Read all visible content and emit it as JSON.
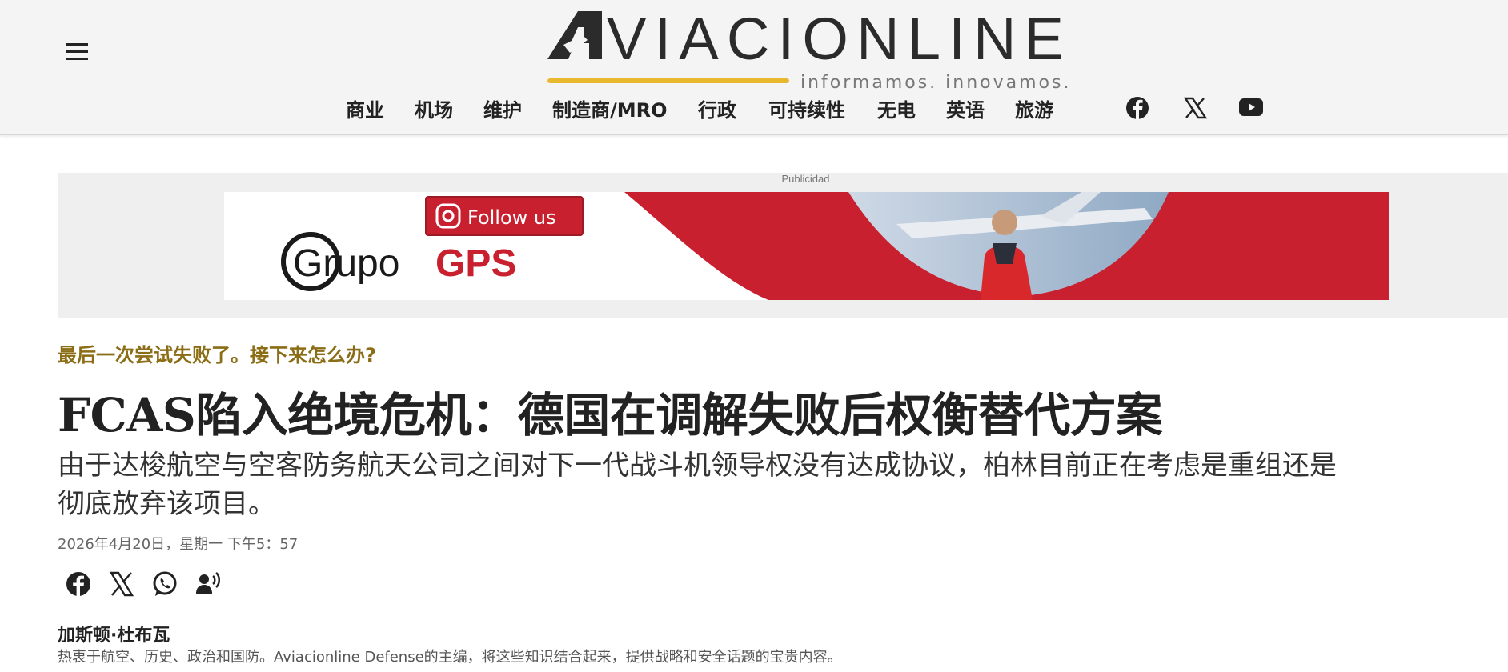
{
  "header": {
    "logo_text": "AVIACIONLINE",
    "tagline": "informamos. innovamos.",
    "brand_color": "#e8b92f",
    "menu_icon": "hamburger-menu-icon",
    "nav": [
      "商业",
      "机场",
      "维护",
      "制造商/MRO",
      "行政",
      "可持续性",
      "无电",
      "英语",
      "旅游"
    ],
    "social": [
      "facebook-icon",
      "x-icon",
      "youtube-icon"
    ]
  },
  "ad": {
    "label": "Publicidad",
    "follow_text": "Follow us",
    "brand_prefix": "Grupo",
    "brand_suffix": "GPS",
    "accent_color": "#c8202f"
  },
  "article": {
    "kicker": "最后一次尝试失败了。接下来怎么办?",
    "kicker_color": "#8a6d14",
    "headline": "FCAS陷入绝境危机：德国在调解失败后权衡替代方案",
    "subhead": "由于达梭航空与空客防务航天公司之间对下一代战斗机领导权没有达成协议，柏林目前正在考虑是重组还是彻底放弃该项目。",
    "date": "2026年4月20日，星期一 下午5：57",
    "share_icons": [
      "facebook-icon",
      "x-icon",
      "whatsapp-icon",
      "listen-icon"
    ],
    "author_name": "加斯顿·杜布瓦",
    "author_bio": "热衷于航空、历史、政治和国防。Aviacionline Defense的主编，将这些知识结合起来，提供战略和安全话题的宝贵内容。"
  }
}
